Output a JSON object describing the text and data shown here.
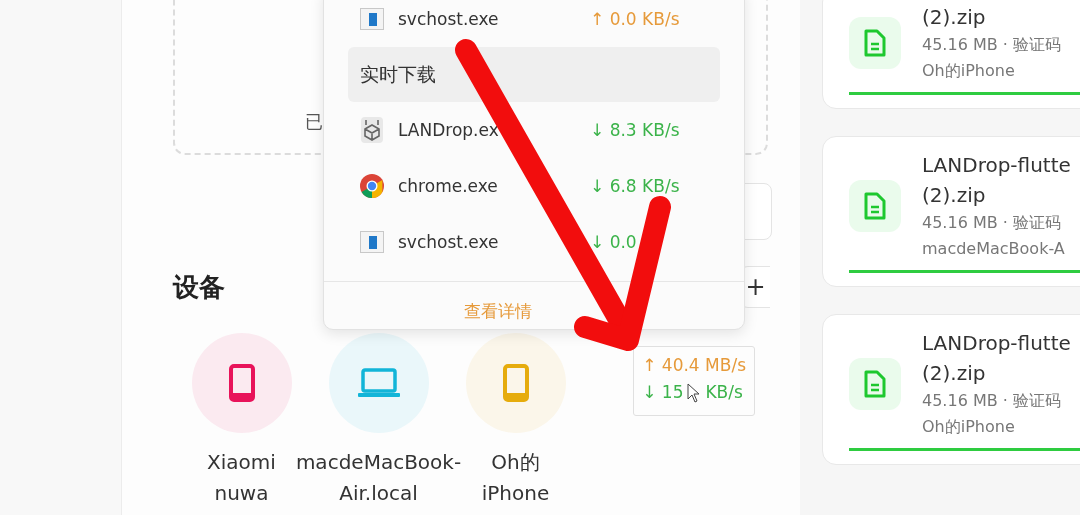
{
  "drop_zone": {
    "text": "已"
  },
  "devices_section": {
    "title": "设备",
    "add_button": "+"
  },
  "devices": [
    {
      "name_lines": [
        "Xiaomi",
        "nuwa"
      ],
      "kind": "phone",
      "color": "#e8135a"
    },
    {
      "name_lines": [
        "macdeMacBook-",
        "Air.local"
      ],
      "kind": "laptop",
      "color": "#12b5d8"
    },
    {
      "name_lines": [
        "Oh的",
        "iPhone"
      ],
      "kind": "phone",
      "color": "#e6ac0c"
    }
  ],
  "traffic": {
    "up": "↑ 40.4 MB/s",
    "down": "↓ 15",
    "down_unit": "KB/s"
  },
  "popup": {
    "rows": [
      {
        "kind": "window",
        "name": "svchost.exe",
        "speed": "↑ 0.0 KB/s",
        "upload": true
      },
      {
        "kind": "header",
        "label": "实时下载"
      },
      {
        "kind": "box",
        "name": "LANDrop.ex",
        "speed": "↓ 8.3 KB/s",
        "upload": false
      },
      {
        "kind": "chrome",
        "name": "chrome.exe",
        "speed": "↓ 6.8 KB/s",
        "upload": false
      },
      {
        "kind": "window",
        "name": "svchost.exe",
        "speed": "↓ 0.0",
        "upload": false
      }
    ],
    "footer": "查看详情"
  },
  "transfers": [
    {
      "title_lines": [
        "(2).zip"
      ],
      "meta": "45.16 MB · 验证码",
      "sender": "Oh的iPhone",
      "level": 1
    },
    {
      "title_lines": [
        "LANDrop-flutte",
        "(2).zip"
      ],
      "meta": "45.16 MB · 验证码",
      "sender": "macdeMacBook-A",
      "level": 1
    },
    {
      "title_lines": [
        "LANDrop-flutte",
        "(2).zip"
      ],
      "meta": "45.16 MB · 验证码",
      "sender": "Oh的iPhone",
      "level": 1
    }
  ]
}
